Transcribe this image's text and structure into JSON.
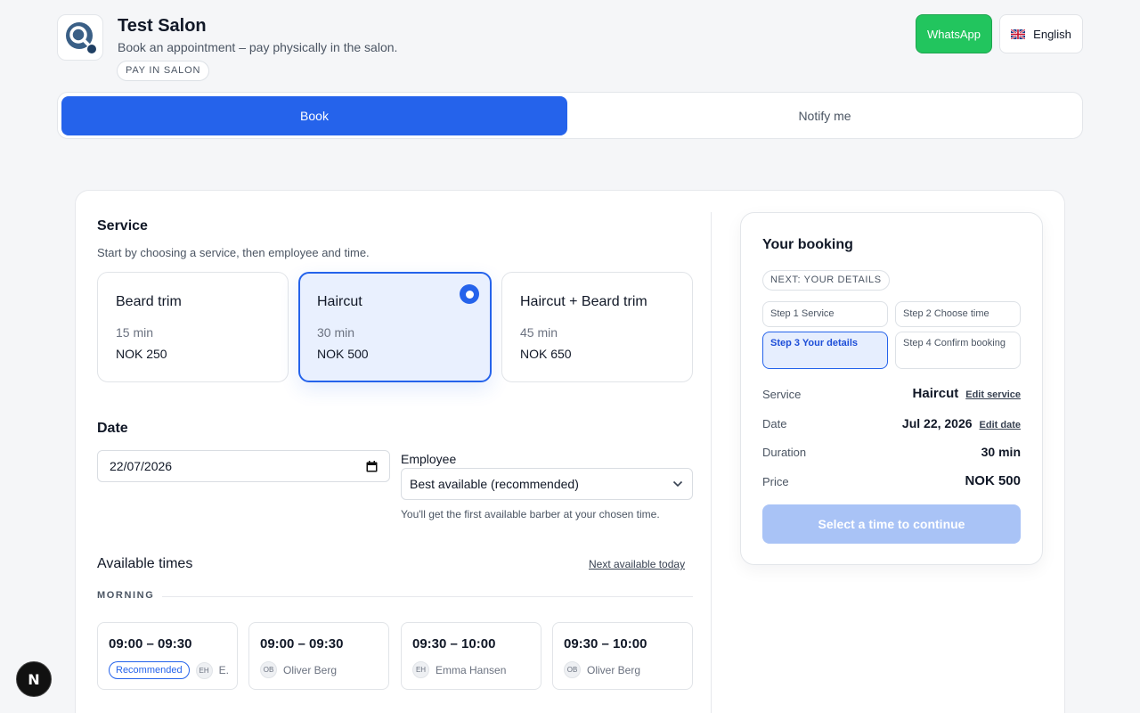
{
  "header": {
    "title": "Test Salon",
    "subtitle": "Book an appointment – pay physically in the salon.",
    "badge": "PAY IN SALON",
    "whatsapp_label": "WhatsApp",
    "language_label": "English",
    "accent_color": "#2563eb",
    "whatsapp_color": "#22c55e"
  },
  "tabs": [
    {
      "label": "Book",
      "active": true
    },
    {
      "label": "Notify me",
      "active": false
    }
  ],
  "service_section": {
    "title": "Service",
    "help": "Start by choosing a service, then employee and time.",
    "services": [
      {
        "name": "Beard trim",
        "duration": "15 min",
        "price": "NOK 250",
        "selected": false
      },
      {
        "name": "Haircut",
        "duration": "30 min",
        "price": "NOK 500",
        "selected": true
      },
      {
        "name": "Haircut + Beard trim",
        "duration": "45 min",
        "price": "NOK 650",
        "selected": false
      }
    ]
  },
  "date_section": {
    "title": "Date",
    "date_value": "22/07/2026",
    "employee_label": "Employee",
    "employee_value": "Best available (recommended)",
    "employee_help": "You'll get the first available barber at your chosen time."
  },
  "times_section": {
    "title": "Available times",
    "next_link": "Next available today",
    "group_label": "MORNING",
    "slots": [
      {
        "time": "09:00 – 09:30",
        "badge": "Recommended",
        "initials": "EH",
        "employee": "E."
      },
      {
        "time": "09:00 – 09:30",
        "initials": "OB",
        "employee": "Oliver Berg"
      },
      {
        "time": "09:30 – 10:00",
        "initials": "EH",
        "employee": "Emma Hansen"
      },
      {
        "time": "09:30 – 10:00",
        "initials": "OB",
        "employee": "Oliver Berg"
      }
    ]
  },
  "booking_summary": {
    "title": "Your booking",
    "next_badge": "NEXT: YOUR DETAILS",
    "steps": [
      {
        "label": "Step 1 Service",
        "active": false
      },
      {
        "label": "Step 2 Choose time",
        "active": false
      },
      {
        "label": "Step 3 Your details",
        "active": true
      },
      {
        "label": "Step 4 Confirm booking",
        "active": false
      }
    ],
    "rows": {
      "service": {
        "label": "Service",
        "value": "Haircut",
        "edit": "Edit service"
      },
      "date": {
        "label": "Date",
        "value": "Jul 22, 2026",
        "edit": "Edit date"
      },
      "duration": {
        "label": "Duration",
        "value": "30 min"
      },
      "price": {
        "label": "Price",
        "value": "NOK 500"
      }
    },
    "cta_label": "Select a time to continue"
  },
  "dev_badge": {
    "letter": "N"
  }
}
